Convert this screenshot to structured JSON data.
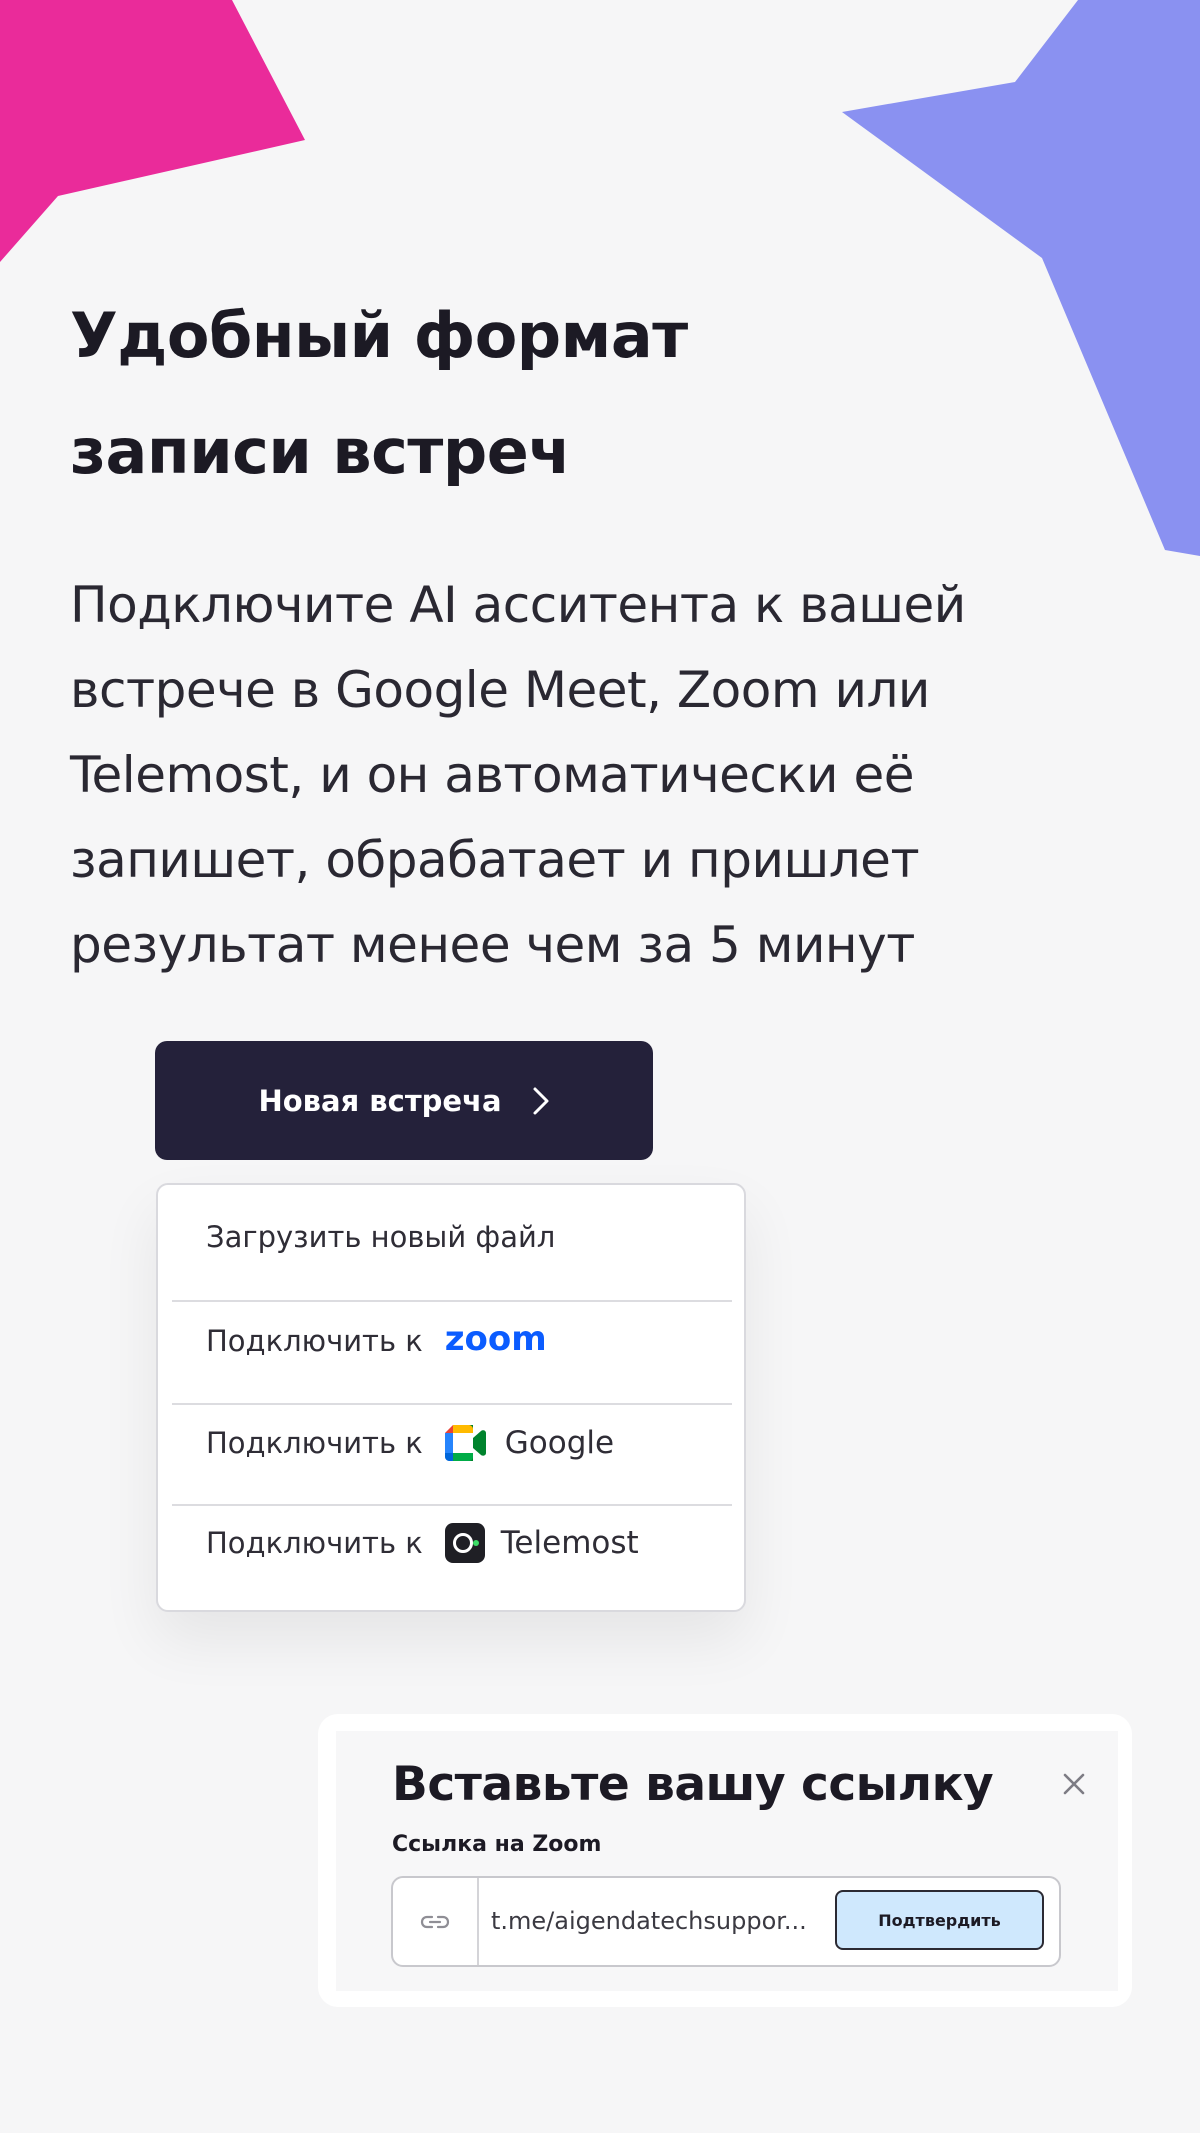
{
  "headline": {
    "line1": "Удобный формат",
    "line2": "записи встреч"
  },
  "description": {
    "line1": "Подключите AI асситента к вашей",
    "line2": "встрече в Google Meet, Zoom или",
    "line3": "Telemost, и он автоматически её",
    "line4": "запишет, обрабатает и пришлет",
    "line5": "результат менее чем за 5 минут"
  },
  "new_meeting_button": {
    "label": "Новая встреча",
    "icon": "chevron-right-icon"
  },
  "menu": {
    "upload_label": "Загрузить новый файл",
    "connect_prefix": "Подключить к",
    "zoom_logo_text": "zoom",
    "google_label": "Google",
    "google_icon": "google-meet-icon",
    "telemost_label": "Telemost",
    "telemost_icon": "telemost-icon"
  },
  "dialog": {
    "title": "Вставьте вашу ссылку",
    "close_icon": "close-icon",
    "field_label": "Ссылка на Zoom",
    "link_icon": "link-icon",
    "link_value": "t.me/aigendatechsuppor...",
    "confirm_label": "Подтвердить"
  },
  "colors": {
    "background": "#f6f6f7",
    "pink_star": "#ea2b9a",
    "violet_star": "#8a91f1",
    "button_dark": "#24213a",
    "zoom_blue": "#0b5cff",
    "confirm_bg": "#cfe8fd"
  }
}
